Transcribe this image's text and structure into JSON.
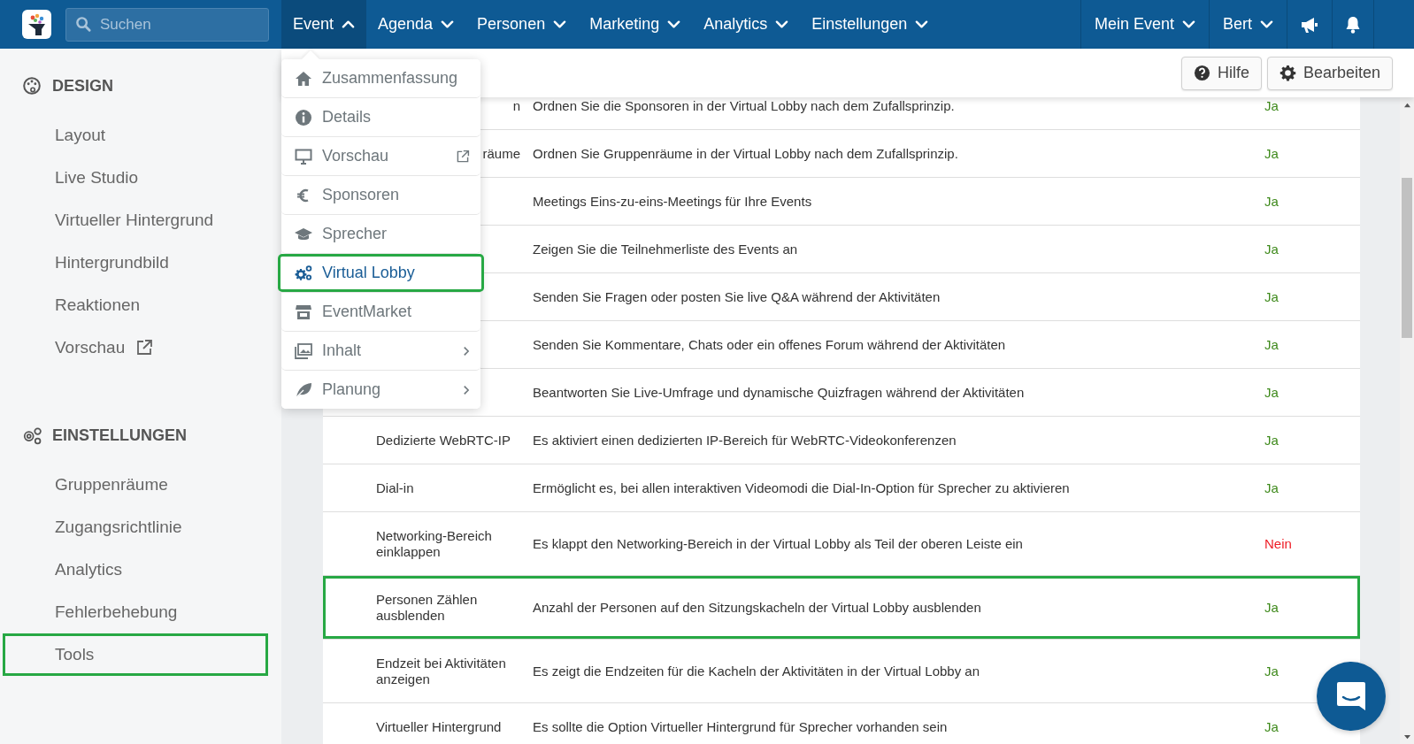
{
  "topbar": {
    "search": {
      "placeholder": "Suchen"
    },
    "nav": [
      {
        "label": "Event",
        "expanded": true
      },
      {
        "label": "Agenda",
        "expanded": false
      },
      {
        "label": "Personen",
        "expanded": false
      },
      {
        "label": "Marketing",
        "expanded": false
      },
      {
        "label": "Analytics",
        "expanded": false
      },
      {
        "label": "Einstellungen",
        "expanded": false
      }
    ],
    "right_menus": [
      {
        "label": "Mein Event"
      },
      {
        "label": "Bert"
      }
    ]
  },
  "event_menu": {
    "items": [
      {
        "label": "Zusammenfassung",
        "selected": false,
        "highlighted": false
      },
      {
        "label": "Details",
        "selected": false,
        "highlighted": false
      },
      {
        "label": "Vorschau",
        "selected": false,
        "highlighted": false,
        "external": true
      },
      {
        "label": "Sponsoren",
        "selected": false,
        "highlighted": false
      },
      {
        "label": "Sprecher",
        "selected": false,
        "highlighted": false
      },
      {
        "label": "Virtual Lobby",
        "selected": true,
        "highlighted": true
      },
      {
        "label": "EventMarket",
        "selected": false,
        "highlighted": false
      },
      {
        "label": "Inhalt",
        "selected": false,
        "highlighted": false,
        "submenu": true
      },
      {
        "label": "Planung",
        "selected": false,
        "highlighted": false,
        "submenu": true
      }
    ]
  },
  "sidebar": {
    "sections": [
      {
        "title": "DESIGN",
        "items": [
          {
            "label": "Layout",
            "highlighted": false
          },
          {
            "label": "Live Studio",
            "highlighted": false
          },
          {
            "label": "Virtueller Hintergrund",
            "highlighted": false
          },
          {
            "label": "Hintergrundbild",
            "highlighted": false
          },
          {
            "label": "Reaktionen",
            "highlighted": false
          },
          {
            "label": "Vorschau",
            "highlighted": false,
            "external": true
          }
        ]
      },
      {
        "title": "EINSTELLUNGEN",
        "items": [
          {
            "label": "Gruppenräume",
            "highlighted": false
          },
          {
            "label": "Zugangsrichtlinie",
            "highlighted": false
          },
          {
            "label": "Analytics",
            "highlighted": false
          },
          {
            "label": "Fehlerbehebung",
            "highlighted": false
          },
          {
            "label": "Tools",
            "highlighted": true
          }
        ]
      }
    ]
  },
  "toolbar": {
    "buttons": [
      "Hilfe",
      "Bearbeiten"
    ]
  },
  "table": {
    "rows": [
      {
        "kind": "cut",
        "name": "n",
        "description": "Ordnen Sie die Sponsoren in der Virtual Lobby nach dem Zufallsprinzip.",
        "value": "Ja",
        "enabled": true,
        "highlighted": false
      },
      {
        "kind": "cut",
        "name": "räume",
        "description": "Ordnen Sie Gruppenräume in der Virtual Lobby nach dem Zufallsprinzip.",
        "value": "Ja",
        "enabled": true,
        "highlighted": false
      },
      {
        "kind": "hidden",
        "description": "Meetings Eins-zu-eins-Meetings für Ihre Events",
        "value": "Ja",
        "enabled": true,
        "highlighted": false
      },
      {
        "kind": "hidden",
        "description": "Zeigen Sie die Teilnehmerliste des Events an",
        "value": "Ja",
        "enabled": true,
        "highlighted": false
      },
      {
        "kind": "hidden",
        "description": "Senden Sie Fragen oder posten Sie live Q&A während der Aktivitäten",
        "value": "Ja",
        "enabled": true,
        "highlighted": false
      },
      {
        "kind": "hidden",
        "description": "Senden Sie Kommentare, Chats oder ein offenes Forum während der Aktivitäten",
        "value": "Ja",
        "enabled": true,
        "highlighted": false
      },
      {
        "kind": "hidden",
        "description": "Beantworten Sie Live-Umfrage und dynamische Quizfragen während der Aktivitäten",
        "value": "Ja",
        "enabled": true,
        "highlighted": false
      },
      {
        "kind": "full",
        "name": "Dedizierte WebRTC-IP",
        "description": "Es aktiviert einen dedizierten IP-Bereich für WebRTC-Videokonferenzen",
        "value": "Ja",
        "enabled": true,
        "highlighted": false
      },
      {
        "kind": "full",
        "name": "Dial-in",
        "description": "Ermöglicht es, bei allen interaktiven Videomodi die Dial-In-Option für Sprecher zu aktivieren",
        "value": "Ja",
        "enabled": true,
        "highlighted": false
      },
      {
        "kind": "full",
        "name": "Networking-Bereich einklappen",
        "description": "Es klappt den Networking-Bereich in der Virtual Lobby als Teil der oberen Leiste ein",
        "value": "Nein",
        "enabled": false,
        "highlighted": false
      },
      {
        "kind": "full",
        "name": "Personen Zählen ausblenden",
        "description": "Anzahl der Personen auf den Sitzungskacheln der Virtual Lobby ausblenden",
        "value": "Ja",
        "enabled": true,
        "highlighted": true
      },
      {
        "kind": "full",
        "name": "Endzeit bei Aktivitäten anzeigen",
        "description": "Es zeigt die Endzeiten für die Kacheln der Aktivitäten in der Virtual Lobby an",
        "value": "Ja",
        "enabled": true,
        "highlighted": false
      },
      {
        "kind": "full",
        "name": "Virtueller Hintergrund",
        "description": "Es sollte die Option Virtueller Hintergrund für Sprecher vorhanden sein",
        "value": "Ja",
        "enabled": true,
        "highlighted": false
      }
    ]
  }
}
